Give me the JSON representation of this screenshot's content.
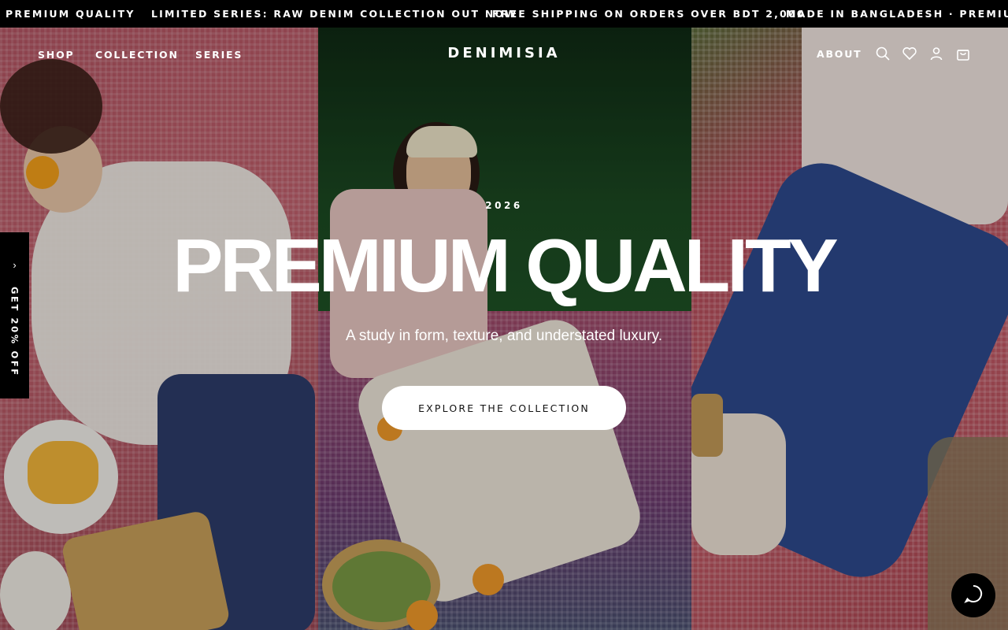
{
  "announcement": {
    "messages": [
      "PREMIUM QUALITY",
      "LIMITED SERIES: RAW DENIM COLLECTION OUT NOW",
      "FREE SHIPPING ON ORDERS OVER BDT 2,000",
      "MADE IN BANGLADESH · PREMIUM QUA"
    ]
  },
  "nav": {
    "left": [
      "SHOP",
      "COLLECTION",
      "SERIES"
    ],
    "logo": "DENIMISIA",
    "about": "ABOUT",
    "icons": [
      "search-icon",
      "heart-icon",
      "user-icon",
      "cart-icon"
    ]
  },
  "hero": {
    "year": "2026",
    "headline": "PREMIUM QUALITY",
    "subline": "A study in form, texture, and understated luxury.",
    "cta": "EXPLORE THE COLLECTION"
  },
  "side_tab": {
    "label": "GET 20% OFF",
    "icon": "chevron-right-icon"
  },
  "chat": {
    "icon": "chat-bubble-icon"
  },
  "colors": {
    "bar": "#000000",
    "text": "#ffffff",
    "button": "#ffffff",
    "button_text": "#111111"
  }
}
